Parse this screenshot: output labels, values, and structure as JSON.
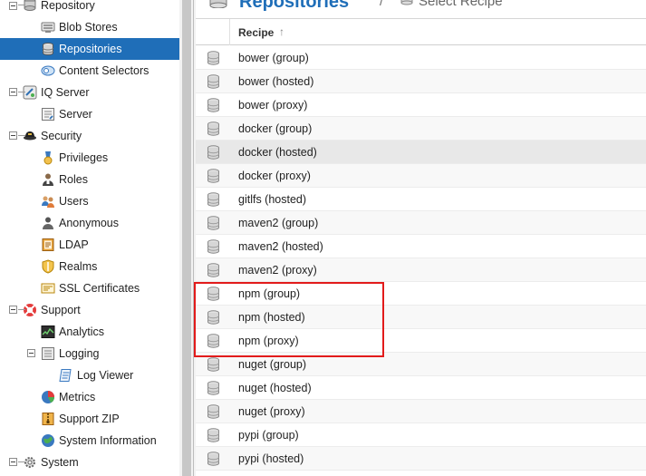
{
  "sidebar": {
    "items": [
      {
        "label": "Repository",
        "icon": "repository-icon"
      },
      {
        "label": "Blob Stores",
        "icon": "blob-store-icon"
      },
      {
        "label": "Repositories",
        "icon": "database-icon",
        "selected": true
      },
      {
        "label": "Content Selectors",
        "icon": "content-selector-icon"
      },
      {
        "label": "IQ Server",
        "icon": "iq-server-icon"
      },
      {
        "label": "Server",
        "icon": "server-config-icon"
      },
      {
        "label": "Security",
        "icon": "security-icon"
      },
      {
        "label": "Privileges",
        "icon": "privilege-medal-icon"
      },
      {
        "label": "Roles",
        "icon": "role-person-icon"
      },
      {
        "label": "Users",
        "icon": "users-icon"
      },
      {
        "label": "Anonymous",
        "icon": "anonymous-user-icon"
      },
      {
        "label": "LDAP",
        "icon": "ldap-book-icon"
      },
      {
        "label": "Realms",
        "icon": "realm-shield-icon"
      },
      {
        "label": "SSL Certificates",
        "icon": "certificate-icon"
      },
      {
        "label": "Support",
        "icon": "support-lifebuoy-icon"
      },
      {
        "label": "Analytics",
        "icon": "analytics-icon"
      },
      {
        "label": "Logging",
        "icon": "logging-icon"
      },
      {
        "label": "Log Viewer",
        "icon": "log-viewer-icon"
      },
      {
        "label": "Metrics",
        "icon": "metrics-pie-icon"
      },
      {
        "label": "Support ZIP",
        "icon": "zip-icon"
      },
      {
        "label": "System Information",
        "icon": "system-info-globe-icon"
      },
      {
        "label": "System",
        "icon": "system-gear-icon"
      }
    ]
  },
  "header": {
    "title": "Repositories",
    "separator": "/",
    "crumb": "Select Recipe"
  },
  "grid": {
    "column_header": "Recipe",
    "sort_indicator": "↑",
    "rows": [
      "bower (group)",
      "bower (hosted)",
      "bower (proxy)",
      "docker (group)",
      "docker (hosted)",
      "docker (proxy)",
      "gitlfs (hosted)",
      "maven2 (group)",
      "maven2 (hosted)",
      "maven2 (proxy)",
      "npm (group)",
      "npm (hosted)",
      "npm (proxy)",
      "nuget (group)",
      "nuget (hosted)",
      "nuget (proxy)",
      "pypi (group)",
      "pypi (hosted)"
    ],
    "hovered_row": "docker (hosted)",
    "highlighted_rows": [
      "npm (group)",
      "npm (hosted)",
      "npm (proxy)"
    ]
  },
  "colors": {
    "selection": "#1f6eb8",
    "title": "#1f6eb8",
    "highlight_border": "#e21b1b"
  }
}
